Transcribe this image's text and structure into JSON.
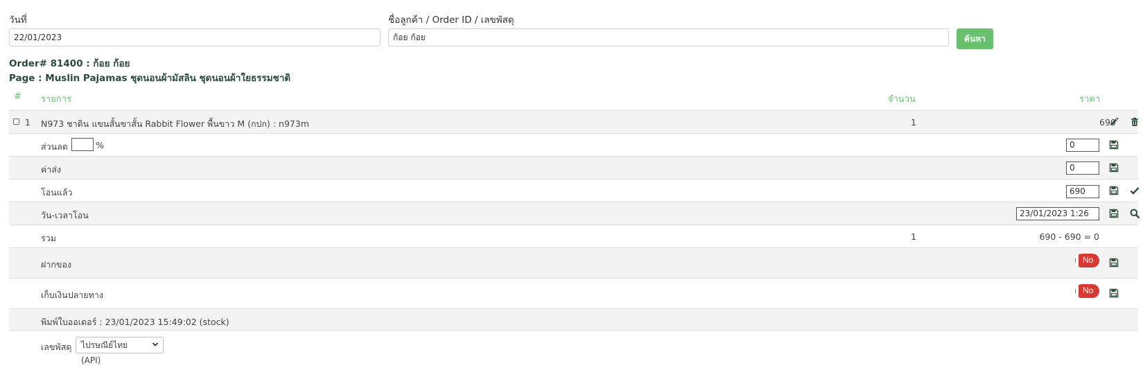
{
  "filters": {
    "date_label": "วันที่",
    "date_value": "22/01/2023",
    "search_label": "ชื่อลูกค้า / Order ID / เลขพัสดุ",
    "search_value": "ก้อย ก้อย",
    "search_button": "ค้นหา"
  },
  "order": {
    "number_line": "Order# 81400 : ก้อย ก้อย",
    "page_line": "Page : Muslin Pajamas ชุดนอนผ้ามัสลิน ชุดนอนผ้าใยธรรมชาติ"
  },
  "table": {
    "headers": {
      "num": "#",
      "item": "รายการ",
      "qty": "จำนวน",
      "price": "ราคา"
    },
    "items": [
      {
        "index": "1",
        "name": "N973 ชาดิน แขนสั้นขาสั้น Rabbit Flower พื้นขาว M (กปก) : n973m",
        "qty": "1",
        "price": "690"
      }
    ],
    "discount": {
      "label": "ส่วนลด",
      "percent_value": "",
      "percent_sign": "%",
      "value": "0"
    },
    "shipping": {
      "label": "ค่าส่ง",
      "value": "0"
    },
    "transferred": {
      "label": "โอนแล้ว",
      "value": "690"
    },
    "transfer_time": {
      "label": "วัน-เวลาโอน",
      "value": "23/01/2023 1:26"
    },
    "total": {
      "label": "รวม",
      "qty": "1",
      "value": "690 - 690 = 0"
    },
    "deposit": {
      "label": "ฝากของ",
      "toggle": "No"
    },
    "cod": {
      "label": "เก็บเงินปลายทาง",
      "toggle": "No"
    },
    "printed": {
      "label": "พิมพ์ใบออเดอร์ : 23/01/2023 15:49:02 (stock)"
    },
    "tracking": {
      "label": "เลขพัสดุ",
      "carrier": "ไปรษณีย์ไทย (API)"
    }
  },
  "colors": {
    "accent_green": "#69c16f",
    "toggle_red": "#d63a32",
    "title_dark_green": "#2a4a3a"
  }
}
